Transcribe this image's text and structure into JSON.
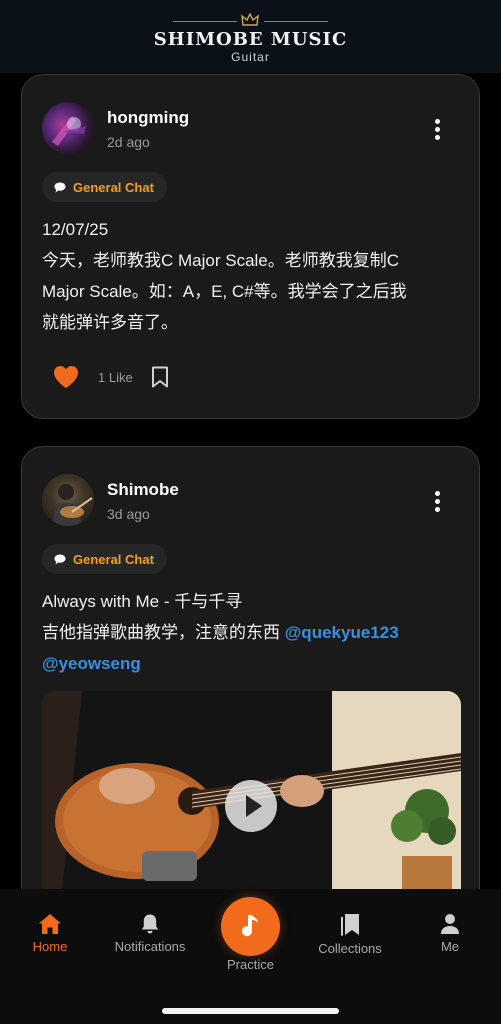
{
  "header": {
    "brand_title": "SHIMOBE MUSIC",
    "brand_sub": "Guitar"
  },
  "posts": [
    {
      "username": "hongming",
      "time_ago": "2d ago",
      "tag": "General Chat",
      "lines": [
        "12/07/25",
        "今天，老师教我C Major Scale。老师教我复制C",
        "Major Scale。如：A，E, C#等。我学会了之后我",
        "就能弹许多音了。"
      ],
      "likes_label": "1 Like",
      "liked": true
    },
    {
      "username": "Shimobe",
      "time_ago": "3d ago",
      "tag": "General Chat",
      "line1": "Always with Me - 千与千寻",
      "line2_prefix": "吉他指弹歌曲教学，注意的东西 ",
      "mention1": "@quekyue123",
      "mention2": "@yeowseng"
    }
  ],
  "nav": {
    "home": "Home",
    "notifications": "Notifications",
    "practice": "Practice",
    "collections": "Collections",
    "me": "Me",
    "active": "home"
  },
  "colors": {
    "accent": "#f26a1b",
    "tag": "#f2a01b",
    "mention": "#3b8fe0"
  }
}
